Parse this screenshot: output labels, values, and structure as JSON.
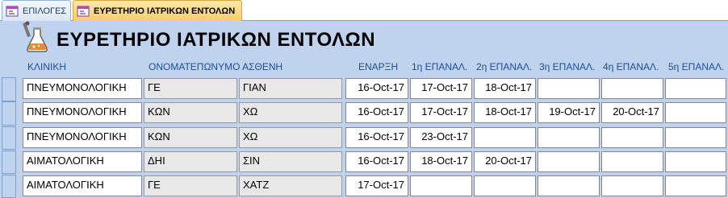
{
  "tabs": [
    {
      "label": "ΕΠΙΛΟΓΕΣ",
      "active": false
    },
    {
      "label": "ΕΥΡΕΤΗΡΙΟ ΙΑΤΡΙΚΩΝ ΕΝΤΟΛΩΝ",
      "active": true
    }
  ],
  "form": {
    "title": "ΕΥΡΕΤΗΡΙΟ ΙΑΤΡΙΚΩΝ ΕΝΤΟΛΩΝ",
    "headers": {
      "clinic": "ΚΛΙΝΙΚΗ",
      "patient": "ΟΝΟΜΑΤΕΠΩΝΥΜΟ ΑΣΘΕΝΗ",
      "start": "ΕΝΑΡΞΗ",
      "rep1": "1η ΕΠΑΝΑΛ.",
      "rep2": "2η ΕΠΑΝΑΛ.",
      "rep3": "3η ΕΠΑΝΑΛ.",
      "rep4": "4η ΕΠΑΝΑΛ.",
      "rep5": "5η ΕΠΑΝΑΛ."
    },
    "rows": [
      {
        "clinic": "ΠΝΕΥΜΟΝΟΛΟΓΙΚΗ",
        "surname": "ΓΕ",
        "firstname": "ΓΙΑΝ",
        "start": "16-Oct-17",
        "rep1": "17-Oct-17",
        "rep2": "18-Oct-17",
        "rep3": "",
        "rep4": "",
        "rep5": ""
      },
      {
        "clinic": "ΠΝΕΥΜΟΝΟΛΟΓΙΚΗ",
        "surname": "ΚΩΝ",
        "firstname": "ΧΩ",
        "start": "16-Oct-17",
        "rep1": "17-Oct-17",
        "rep2": "18-Oct-17",
        "rep3": "19-Oct-17",
        "rep4": "20-Oct-17",
        "rep5": ""
      },
      {
        "clinic": "ΠΝΕΥΜΟΝΟΛΟΓΙΚΗ",
        "surname": "ΚΩΝ",
        "firstname": "ΧΩ",
        "start": "16-Oct-17",
        "rep1": "23-Oct-17",
        "rep2": "",
        "rep3": "",
        "rep4": "",
        "rep5": ""
      },
      {
        "clinic": "ΑΙΜΑΤΟΛΟΓΙΚΗ",
        "surname": "ΔΗΙ",
        "firstname": "ΣΙΝ",
        "start": "16-Oct-17",
        "rep1": "18-Oct-17",
        "rep2": "20-Oct-17",
        "rep3": "",
        "rep4": "",
        "rep5": ""
      },
      {
        "clinic": "ΑΙΜΑΤΟΛΟΓΙΚΗ",
        "surname": "ΓΕ",
        "firstname": "ΧΑΤΖ",
        "start": "17-Oct-17",
        "rep1": "",
        "rep2": "",
        "rep3": "",
        "rep4": "",
        "rep5": ""
      }
    ]
  },
  "icons": {
    "tab_icon": "form-icon",
    "title_icon": "lab-flask-icon"
  },
  "colors": {
    "form_background": "#bfd3ee",
    "header_text": "#1f4e9a",
    "active_tab": "#f8cd68"
  }
}
